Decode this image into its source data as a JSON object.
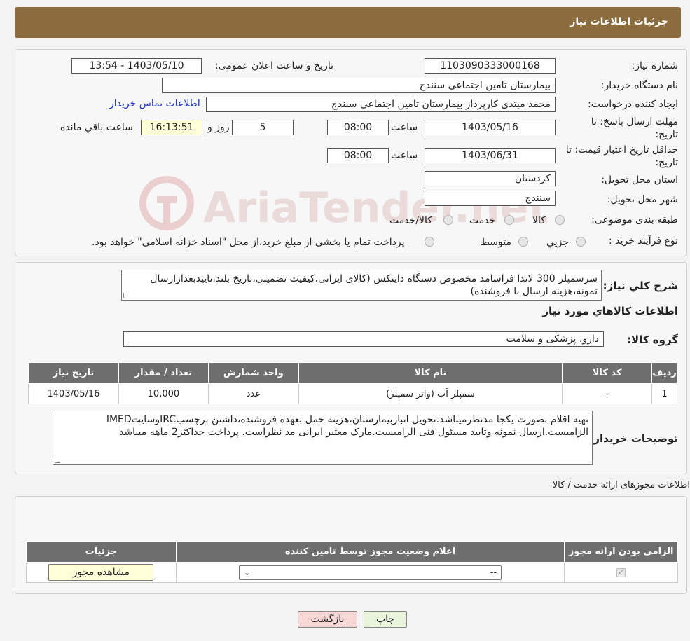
{
  "header": {
    "title": "جزئیات اطلاعات نیاز"
  },
  "form": {
    "need_number_label": "شماره نیاز:",
    "need_number": "1103090333000168",
    "announce_label": "تاریخ و ساعت اعلان عمومی:",
    "announce_value": "1403/05/10 - 13:54",
    "buyer_label": "نام دستگاه خریدار:",
    "buyer_value": "بیمارستان تامین اجتماعی سنندج",
    "creator_label": "ایجاد کننده درخواست:",
    "creator_value": "محمد مبتدی کارپرداز بیمارستان تامین اجتماعی سنندج",
    "contact_link": "اطلاعات تماس خریدار",
    "deadline_label": "مهلت ارسال پاسخ: تا تاریخ:",
    "deadline_date": "1403/05/16",
    "time_label": "ساعت",
    "deadline_time": "08:00",
    "days_value": "5",
    "days_label": "روز و",
    "remaining_time": "16:13:51",
    "remaining_label": "ساعت باقي مانده",
    "validity_label": "حداقل تاریخ اعتبار قیمت: تا تاریخ:",
    "validity_date": "1403/06/31",
    "validity_time": "08:00",
    "province_label": "استان محل تحویل:",
    "province_value": "کردستان",
    "city_label": "شهر محل تحویل:",
    "city_value": "سنندج",
    "category_label": "طبقه بندی موضوعی:",
    "category_options": [
      "کالا",
      "خدمت",
      "کالا/خدمت"
    ],
    "process_label": "نوع فرآیند خرید :",
    "process_options": [
      "جزيي",
      "متوسط"
    ],
    "process_note": "پرداخت تمام یا بخشی از مبلغ خرید،از محل \"اسناد خزانه اسلامی\" خواهد بود."
  },
  "summary": {
    "label": "شرح کلي نياز:",
    "text": "سرسمپلر 300 لاندا فراسامد مخصوص دستگاه داینکس (کالای ایرانی،کیفیت تضمینی،تاریخ بلند،تاییدبعدازارسال نمونه،هزینه ارسال با فروشنده)",
    "items_title": "اطلاعات کالاهاي مورد نياز",
    "group_label": "گروه کالا:",
    "group_value": "دارو، پزشکی و سلامت"
  },
  "items_table": {
    "headers": [
      "رديف",
      "کد کالا",
      "نام کالا",
      "واحد شمارش",
      "تعداد / مقدار",
      "تاریخ نیاز"
    ],
    "rows": [
      [
        "1",
        "--",
        "سمپلر آب (واتر سمپلر)",
        "عدد",
        "10,000",
        "1403/05/16"
      ]
    ]
  },
  "buyer_notes": {
    "label": "توضیحات خریدار:",
    "text": "تهیه اقلام بصورت یکجا مدنظرمیباشد.تحویل انباربیمارستان،هزینه حمل بعهده فروشنده،داشتن برچسبIRCوسایتIMED الزامیست.ارسال نمونه وتایید مسئول فنی الزامیست.مارک معتبر ایرانی مد نظراست. پرداخت حداکثر2 ماهه میباشد"
  },
  "permits": {
    "section_title": "اطلاعات مجوزهای ارائه خدمت / کالا",
    "headers": [
      "الزامی بودن ارائه مجوز",
      "اعلام وضعیت مجوز توسط تامین کننده",
      "جزئیات"
    ],
    "select_value": "--",
    "view_button": "مشاهده مجوز"
  },
  "buttons": {
    "print": "چاپ",
    "back": "بازگشت"
  },
  "watermark": "AriaTender.net",
  "colors": {
    "header": "#8b6c3e",
    "table_header": "#6e6e6e",
    "link": "#1a33c8",
    "back_button": "#f8d7d7",
    "print_button": "#e8f5dc",
    "remaining_bg": "#ffffd8"
  }
}
